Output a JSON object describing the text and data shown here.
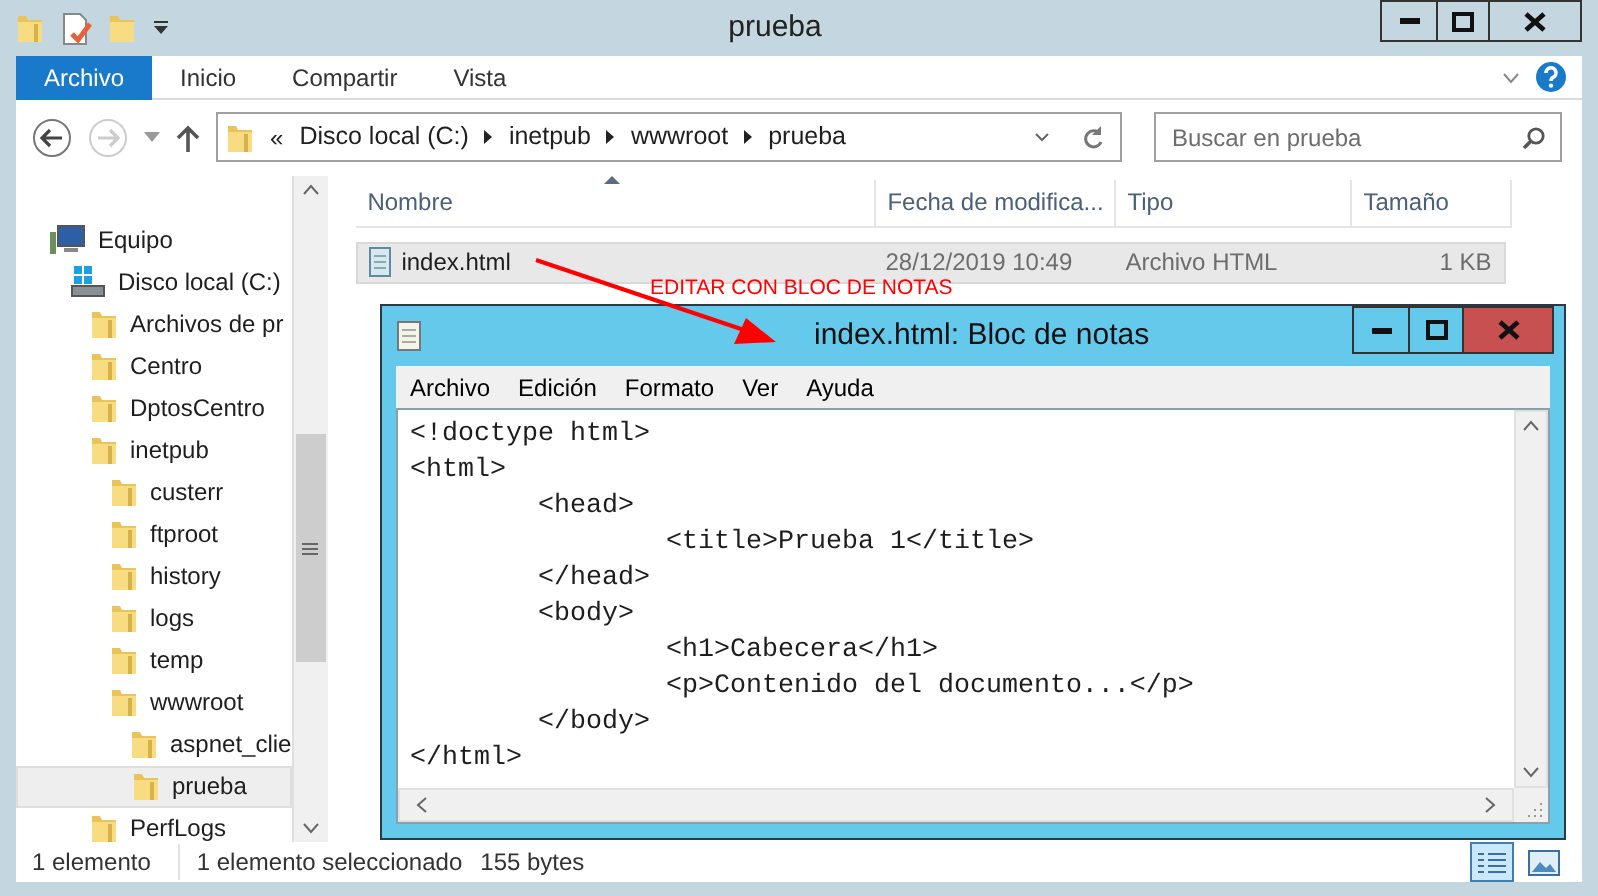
{
  "window": {
    "title": "prueba"
  },
  "ribbon_tabs": [
    {
      "label": "Archivo",
      "selected": true
    },
    {
      "label": "Inicio",
      "selected": false
    },
    {
      "label": "Compartir",
      "selected": false
    },
    {
      "label": "Vista",
      "selected": false
    }
  ],
  "address": {
    "overflow": "«",
    "segments": [
      "Disco local (C:)",
      "inetpub",
      "wwwroot",
      "prueba"
    ]
  },
  "search": {
    "placeholder": "Buscar en prueba"
  },
  "nav_tree": [
    {
      "label": "Equipo",
      "kind": "computer",
      "selected": false,
      "children": [
        {
          "label": "Disco local (C:)",
          "kind": "drive",
          "selected": false,
          "children": [
            {
              "label": "Archivos de pr",
              "kind": "folder",
              "selected": false
            },
            {
              "label": "Centro",
              "kind": "folder",
              "selected": false
            },
            {
              "label": "DptosCentro",
              "kind": "folder",
              "selected": false
            },
            {
              "label": "inetpub",
              "kind": "folder",
              "selected": false,
              "children": [
                {
                  "label": "custerr",
                  "kind": "folder",
                  "selected": false
                },
                {
                  "label": "ftproot",
                  "kind": "folder",
                  "selected": false
                },
                {
                  "label": "history",
                  "kind": "folder",
                  "selected": false
                },
                {
                  "label": "logs",
                  "kind": "folder",
                  "selected": false
                },
                {
                  "label": "temp",
                  "kind": "folder",
                  "selected": false
                },
                {
                  "label": "wwwroot",
                  "kind": "folder",
                  "selected": false,
                  "children": [
                    {
                      "label": "aspnet_clie",
                      "kind": "folder",
                      "selected": false
                    },
                    {
                      "label": "prueba",
                      "kind": "folder",
                      "selected": true
                    }
                  ]
                }
              ]
            },
            {
              "label": "PerfLogs",
              "kind": "folder",
              "selected": false
            }
          ]
        }
      ]
    }
  ],
  "columns": [
    "Nombre",
    "Fecha de modifica...",
    "Tipo",
    "Tamaño"
  ],
  "files": [
    {
      "name": "index.html",
      "modified": "28/12/2019 10:49",
      "type": "Archivo HTML",
      "size": "1 KB",
      "selected": true
    }
  ],
  "annotation": {
    "text": "EDITAR CON BLOC DE NOTAS"
  },
  "notepad": {
    "title": "index.html: Bloc de notas",
    "menu": [
      "Archivo",
      "Edición",
      "Formato",
      "Ver",
      "Ayuda"
    ],
    "lines": [
      "<!doctype html>",
      "<html>",
      "\t<head>",
      "\t\t<title>Prueba 1</title>",
      "\t</head>",
      "\t<body>",
      "\t\t<h1>Cabecera</h1>",
      "\t\t<p>Contenido del documento...</p>",
      "\t</body>",
      "</html>"
    ]
  },
  "status_bar": {
    "items": [
      "1 elemento",
      "1 elemento seleccionado",
      "155 bytes"
    ]
  },
  "view_buttons": [
    {
      "kind": "details",
      "selected": true
    },
    {
      "kind": "large_icons",
      "selected": false
    }
  ]
}
